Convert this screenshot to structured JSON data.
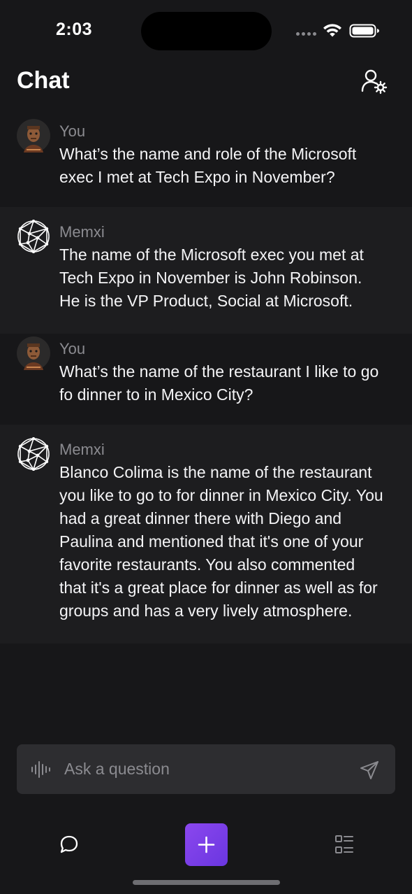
{
  "status_bar": {
    "time": "2:03"
  },
  "header": {
    "title": "Chat",
    "settings_icon": "user-gear-icon"
  },
  "messages": [
    {
      "role": "user",
      "sender": "You",
      "avatar": "user-avatar",
      "text": "What’s the name and role of the Microsoft exec I met at Tech Expo in November?"
    },
    {
      "role": "assistant",
      "sender": "Memxi",
      "avatar": "memxi-network-logo",
      "text": "The name of the Microsoft exec you met at Tech Expo in November is John Robinson. He is the VP Product, Social at Microsoft."
    },
    {
      "role": "user",
      "sender": "You",
      "avatar": "user-avatar",
      "text": "What’s the name of the restaurant I like to go fo dinner to in Mexico City?"
    },
    {
      "role": "assistant",
      "sender": "Memxi",
      "avatar": "memxi-network-logo",
      "text": "Blanco Colima is the name of the restaurant you like to go to for dinner in Mexico City. You had a great dinner there with Diego and Paulina and mentioned that it's one of your favorite restaurants. You also commented that it's a great place for dinner as well as for groups and has a very lively atmosphere."
    }
  ],
  "input": {
    "placeholder": "Ask a question",
    "value": "",
    "voice_icon": "waveform-icon",
    "send_icon": "send-icon"
  },
  "tab_bar": {
    "chat_icon": "chat-bubble-icon",
    "add_icon": "plus-icon",
    "list_icon": "list-icon",
    "accent_color": "#7c3aed"
  }
}
